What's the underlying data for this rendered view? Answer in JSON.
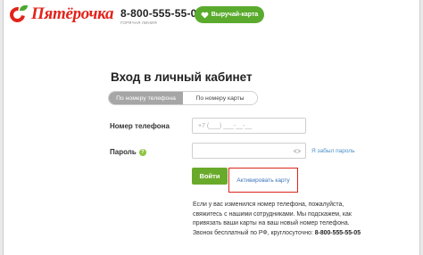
{
  "header": {
    "logo_text": "Пятёрочка",
    "phone_number": "8-800-555-55-05",
    "phone_caption": "горячая линия",
    "card_button_label": "Выручай-карта"
  },
  "login": {
    "title": "Вход в личный кабинет",
    "tabs": [
      {
        "label": "По номеру телефона",
        "active": true
      },
      {
        "label": "По номеру карты",
        "active": false
      }
    ],
    "phone_label": "Номер телефона",
    "phone_placeholder": "+7 (___) ___-__-__",
    "password_label": "Пароль",
    "password_placeholder": "",
    "forgot_link": "Я забыл пароль",
    "login_button": "Войти",
    "activate_link": "Активировать карту"
  },
  "info": {
    "lines": [
      "Если у вас изменился номер телефона, пожалуйста,",
      "свяжитесь с нашими сотрудниками. Мы подскажем, как",
      "привязать ваши карты на ваш новый номер телефона."
    ],
    "hotline_prefix": "Звонок бесплатный по РФ, круглосуточно:",
    "hotline_number": "8-800-555-55-05"
  },
  "colors": {
    "brand_red": "#e2231a",
    "brand_green": "#5aab2d",
    "link_blue": "#3a73b8",
    "highlight_red": "#d9261c"
  },
  "icons": [
    "logo-icon",
    "heart-icon",
    "help-icon",
    "eye-icon"
  ]
}
